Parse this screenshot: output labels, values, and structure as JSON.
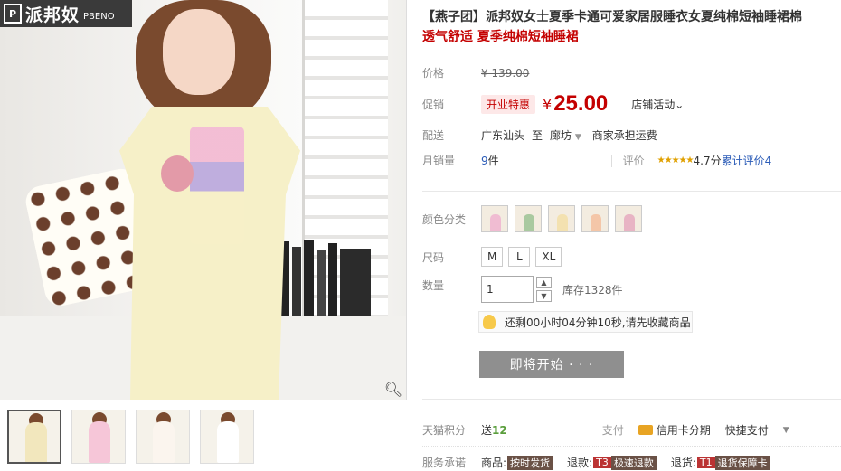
{
  "brand": {
    "logo_cn": "派邦奴",
    "logo_en": "PBENO",
    "mark": "P"
  },
  "product": {
    "title": "【燕子团】派邦奴女士夏季卡通可爱家居服睡衣女夏纯棉短袖睡裙棉",
    "subtitle": "透气舒适 夏季纯棉短袖睡裙"
  },
  "price": {
    "label": "价格",
    "original": "¥ 139.00"
  },
  "promo": {
    "label": "促销",
    "badge": "开业特惠",
    "currency": "¥",
    "value": "25.00",
    "shop_activity": "店铺活动"
  },
  "delivery": {
    "label": "配送",
    "from": "广东汕头",
    "to_word": "至",
    "to": "廊坊",
    "shipping": "商家承担运费"
  },
  "sales": {
    "label": "月销量",
    "count": "9",
    "unit": "件",
    "rating_label": "评价",
    "rating_score": "4.7分",
    "reviews_text": "累计评价4"
  },
  "options": {
    "color_label": "颜色分类",
    "colors": [
      "#f0bcd2",
      "#a9c9a0",
      "#f3e1b0",
      "#f4c6a8",
      "#e8b4c4"
    ],
    "size_label": "尺码",
    "sizes": [
      "M",
      "L",
      "XL"
    ],
    "qty_label": "数量",
    "qty_value": "1",
    "stock": "库存1328件"
  },
  "notice": {
    "text": "还剩00小时04分钟10秒,请先收藏商品"
  },
  "buy": {
    "label": "即将开始 · · ·"
  },
  "points": {
    "label": "天猫积分",
    "send": "送",
    "value": "12",
    "pay_label": "支付",
    "pay_card": "信用卡分期",
    "quick_pay": "快捷支付"
  },
  "service": {
    "label": "服务承诺",
    "goods": "商品:",
    "goods_tag": "按时发货",
    "refund": "退款:",
    "refund_tag_prefix": "T3",
    "refund_tag": "极速退款",
    "return": "退货:",
    "return_tag_prefix": "T1",
    "return_tag": "退货保障卡"
  },
  "thumb_colors": [
    "#f2e7bd",
    "#f6c6d8",
    "#fbf5ee",
    "#ffffff"
  ]
}
